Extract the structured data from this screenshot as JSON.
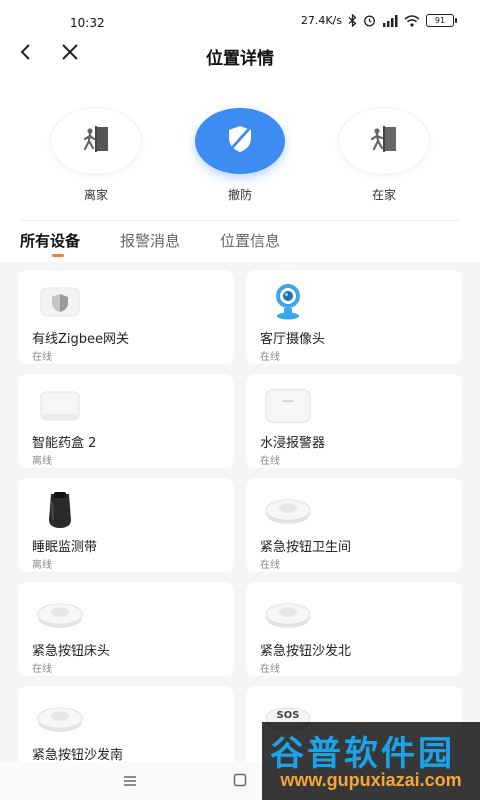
{
  "status_bar": {
    "time": "10:32",
    "net_speed": "27.4K/s",
    "battery": "91"
  },
  "header": {
    "title": "位置详情"
  },
  "modes": [
    {
      "label": "离家",
      "icon": "person-exit-icon",
      "active": false
    },
    {
      "label": "撤防",
      "icon": "shield-off-icon",
      "active": true
    },
    {
      "label": "在家",
      "icon": "person-enter-icon",
      "active": false
    }
  ],
  "tabs": [
    {
      "label": "所有设备",
      "active": true
    },
    {
      "label": "报警消息",
      "active": false
    },
    {
      "label": "位置信息",
      "active": false
    }
  ],
  "devices": [
    {
      "name": "有线Zigbee网关",
      "status": "在线",
      "icon": "gateway-icon"
    },
    {
      "name": "客厅摄像头",
      "status": "在线",
      "icon": "camera-icon"
    },
    {
      "name": "智能药盒 2",
      "status": "离线",
      "icon": "pill-box-icon"
    },
    {
      "name": "水浸报警器",
      "status": "在线",
      "icon": "water-sensor-icon"
    },
    {
      "name": "睡眠监测带",
      "status": "离线",
      "icon": "sleep-band-icon"
    },
    {
      "name": "紧急按钮卫生间",
      "status": "在线",
      "icon": "emergency-button-icon"
    },
    {
      "name": "紧急按钮床头",
      "status": "在线",
      "icon": "emergency-button-icon"
    },
    {
      "name": "紧急按钮沙发北",
      "status": "在线",
      "icon": "emergency-button-icon"
    },
    {
      "name": "紧急按钮沙发南",
      "status": "",
      "icon": "emergency-button-icon"
    },
    {
      "name": "",
      "status": "",
      "icon": "sos-button-icon",
      "icon_text": "SOS"
    }
  ],
  "watermark": {
    "title": "谷普软件园",
    "url": "www.gupuxiazai.com"
  },
  "colors": {
    "accent_blue": "#3d8cf1",
    "tab_indicator": "#f07e3a",
    "camera_blue": "#3aa6f0",
    "page_bg": "#f5f5f5"
  }
}
